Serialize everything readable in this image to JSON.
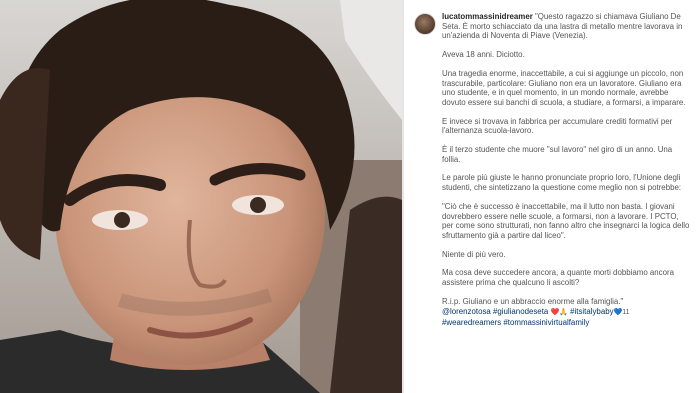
{
  "post": {
    "username": "lucatommassinidreamer",
    "caption_lead": "\"Questo ragazzo si chiamava Giuliano De Seta. È morto schiacciato da una lastra di metallo mentre lavorava in un'azienda di Noventa di Piave (Venezia).",
    "p1": "Aveva 18 anni. Diciotto.",
    "p2": "Una tragedia enorme, inaccettabile, a cui si aggiunge un piccolo, non trascurabile, particolare: Giuliano non era un lavoratore. Giuliano era uno studente, e in quel momento, in un mondo normale, avrebbe dovuto essere sui banchi di scuola, a studiare, a formarsi, a imparare.",
    "p3": "E invece si trovava in fabbrica per accumulare crediti formativi per l'alternanza scuola-lavoro.",
    "p4": "È il terzo studente che muore \"sul lavoro\" nel giro di un anno. Una follia.",
    "p5": "Le parole più giuste le hanno pronunciate proprio loro, l'Unione degli studenti, che sintetizzano la questione come meglio non si potrebbe:",
    "p6": "\"Ciò che è successo è inaccettabile, ma il lutto non basta. I giovani dovrebbero essere nelle scuole, a formarsi, non a lavorare. I PCTO, per come sono strutturati, non fanno altro che insegnarci la logica dello sfruttamento già a partire dal liceo\".",
    "p7": "Niente di più vero.",
    "p8": "Ma cosa deve succedere ancora, a quante morti dobbiamo ancora assistere prima che qualcuno li ascolti?",
    "p9": "R.i.p. Giuliano e un abbraccio enorme alla famiglia.\"",
    "tags1": "@lorenzotosa #giulianodeseta",
    "tags2": "#itsitalybaby",
    "tags3": "#wearedreamers #tommassinivirtualfamily",
    "emoji1": "❤️🙏",
    "emoji2": "💙11"
  }
}
